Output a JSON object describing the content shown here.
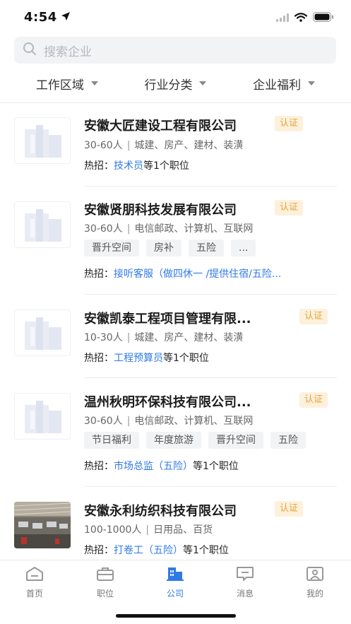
{
  "status": {
    "time": "4:54"
  },
  "search": {
    "placeholder": "搜索企业"
  },
  "filters": [
    {
      "label": "工作区域"
    },
    {
      "label": "行业分类"
    },
    {
      "label": "企业福利"
    }
  ],
  "companies": [
    {
      "name": "安徽大匠建设工程有限公司",
      "badge": "认证",
      "size": "30-60人",
      "industry": "城建、房产、建材、装潢",
      "tags": [],
      "hot_prefix": "热招：",
      "hot_job": "技术员",
      "hot_suffix": "等1个职位",
      "logo": "building"
    },
    {
      "name": "安徽贤朋科技发展有限公司",
      "badge": "认证",
      "size": "30-60人",
      "industry": "电信邮政、计算机、互联网",
      "tags": [
        "晋升空间",
        "房补",
        "五险",
        "..."
      ],
      "hot_prefix": "热招：",
      "hot_job": "接听客服（做四休一 /提供住宿/五险...",
      "hot_suffix": "",
      "logo": "building"
    },
    {
      "name": "安徽凯泰工程项目管理有限...",
      "badge": "认证",
      "size": "10-30人",
      "industry": "城建、房产、建材、装潢",
      "tags": [],
      "hot_prefix": "热招：",
      "hot_job": "工程预算员",
      "hot_suffix": "等1个职位",
      "logo": "building"
    },
    {
      "name": "温州秋明环保科技有限公司...",
      "badge": "认证",
      "size": "30-60人",
      "industry": "电信邮政、计算机、互联网",
      "tags": [
        "节日福利",
        "年度旅游",
        "晋升空间",
        "五险"
      ],
      "hot_prefix": "热招：",
      "hot_job": "市场总监（五险）",
      "hot_suffix": "等1个职位",
      "logo": "building"
    },
    {
      "name": "安徽永利纺织科技有限公司",
      "badge": "认证",
      "size": "100-1000人",
      "industry": "日用品、百货",
      "tags": [],
      "hot_prefix": "热招：",
      "hot_job": "打卷工（五险）",
      "hot_suffix": "等1个职位",
      "logo": "factory-photo"
    }
  ],
  "tabs": [
    {
      "label": "首页",
      "icon": "home-icon"
    },
    {
      "label": "职位",
      "icon": "briefcase-icon"
    },
    {
      "label": "公司",
      "icon": "company-icon",
      "active": true
    },
    {
      "label": "消息",
      "icon": "message-icon"
    },
    {
      "label": "我的",
      "icon": "profile-icon"
    }
  ],
  "colors": {
    "accent": "#2f7ae5",
    "badge_bg": "#fdf1dc",
    "badge_text": "#e6a23c"
  }
}
